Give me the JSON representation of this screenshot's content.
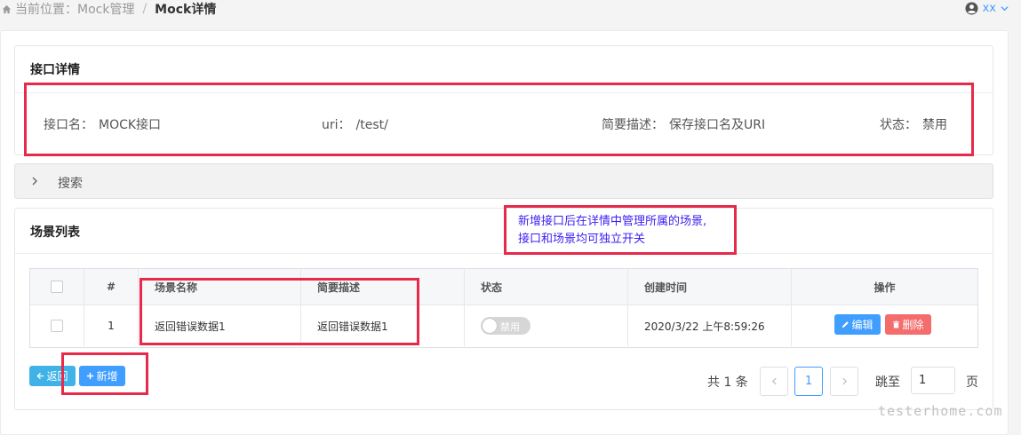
{
  "breadcrumb": {
    "prefix": "当前位置：",
    "parent": "Mock管理",
    "separator": "/",
    "current": "Mock详情"
  },
  "user": {
    "name": "xx"
  },
  "detail": {
    "title": "接口详情",
    "name_label": "接口名：",
    "name_value": "MOCK接口",
    "uri_label": "uri：",
    "uri_value": "/test/",
    "desc_label": "简要描述：",
    "desc_value": "保存接口名及URI",
    "status_label": "状态：",
    "status_value": "禁用"
  },
  "search": {
    "label": "搜索"
  },
  "scenes": {
    "title": "场景列表",
    "columns": [
      "#",
      "场景名称",
      "简要描述",
      "状态",
      "创建时间",
      "操作"
    ],
    "rows": [
      {
        "index": "1",
        "name": "返回错误数据1",
        "desc": "返回错误数据1",
        "status": "禁用",
        "created": "2020/3/22 上午8:59:26",
        "edit": "编辑",
        "delete": "删除"
      }
    ]
  },
  "actions": {
    "back": "返回",
    "add": "新增"
  },
  "pagination": {
    "total": "共 1 条",
    "current_page": "1",
    "jump_label": "跳至",
    "jump_value": "1",
    "page_unit": "页"
  },
  "annotation": {
    "line1": "新增接口后在详情中管理所属的场景,",
    "line2": "接口和场景均可独立开关"
  },
  "watermark": "testerhome.com",
  "colors": {
    "primary": "#409eff",
    "danger": "#f56c6c",
    "highlight": "#e8294a",
    "note": "#3b1ff0"
  }
}
